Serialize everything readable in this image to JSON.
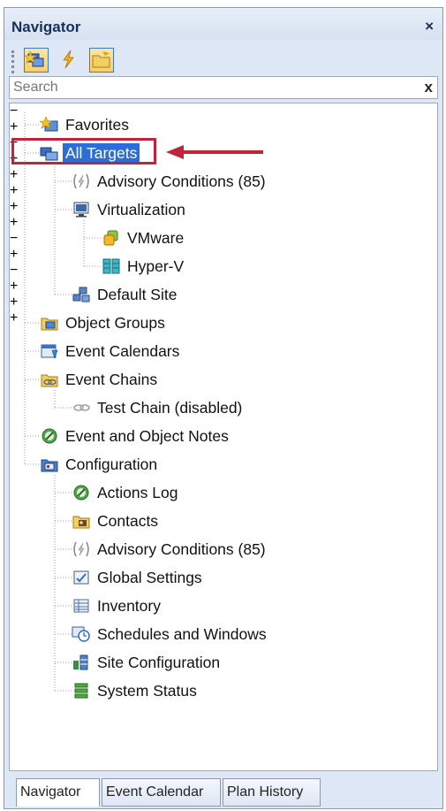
{
  "panel": {
    "title": "Navigator",
    "close_glyph": "×"
  },
  "toolbar": {
    "buttons": [
      {
        "icon": "targets-icon",
        "selected": true
      },
      {
        "icon": "lightning-icon",
        "selected": false
      },
      {
        "icon": "folder-icon",
        "selected": true
      }
    ]
  },
  "search": {
    "placeholder": "Search",
    "clear_glyph": "x"
  },
  "tree": {
    "favorites": "Favorites",
    "all_targets": "All Targets",
    "advisory_conditions": "Advisory Conditions (85)",
    "virtualization": "Virtualization",
    "vmware": "VMware",
    "hyperv": "Hyper-V",
    "default_site": "Default Site",
    "object_groups": "Object Groups",
    "event_calendars": "Event Calendars",
    "event_chains": "Event Chains",
    "test_chain": "Test Chain (disabled)",
    "event_object_notes": "Event and Object Notes",
    "configuration": "Configuration",
    "actions_log": "Actions Log",
    "contacts": "Contacts",
    "advisory_conditions_2": "Advisory Conditions (85)",
    "global_settings": "Global Settings",
    "inventory": "Inventory",
    "schedules_windows": "Schedules and Windows",
    "site_configuration": "Site Configuration",
    "system_status": "System Status"
  },
  "tabs": [
    "Navigator",
    "Event Calendar",
    "Plan History"
  ],
  "colors": {
    "selection": "#2b6fd6",
    "highlight_box": "#c0243a",
    "arrow": "#c0243a"
  }
}
